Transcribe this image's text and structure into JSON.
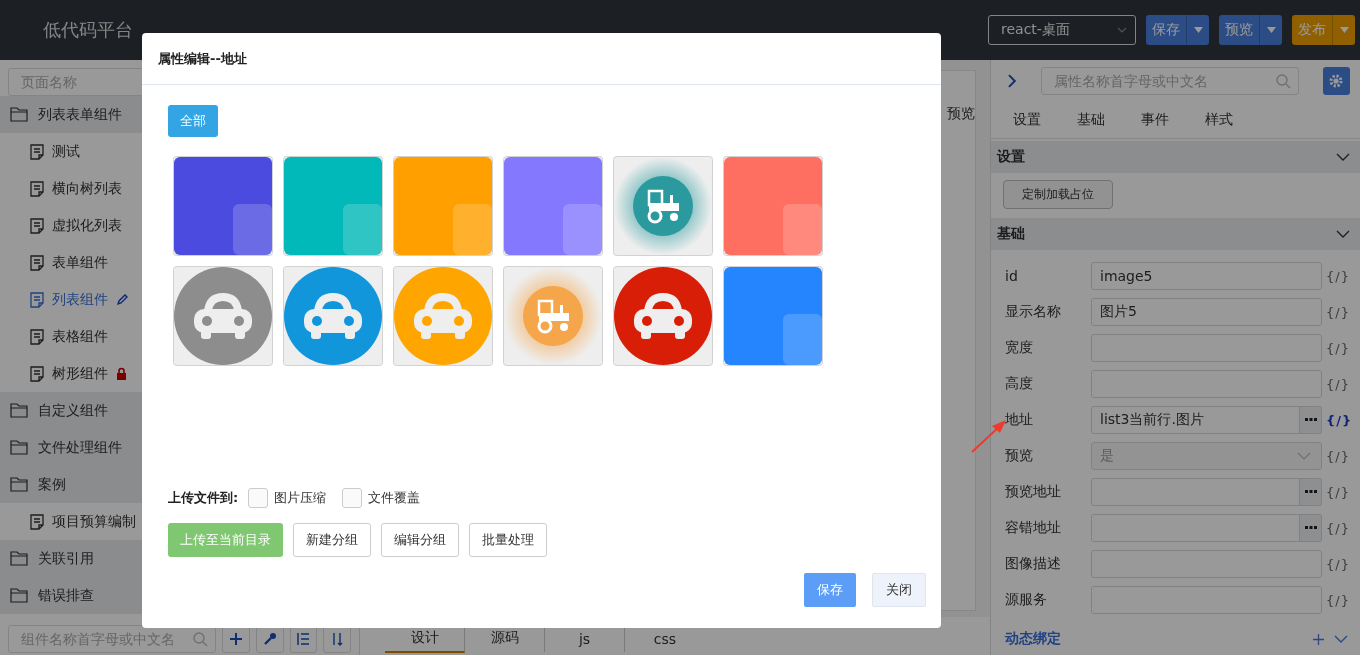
{
  "header": {
    "logo": "低代码平台",
    "env_select": "react-桌面",
    "actions": [
      {
        "label": "保存",
        "kind": "primary"
      },
      {
        "label": "预览",
        "kind": "primary"
      },
      {
        "label": "发布",
        "kind": "warning"
      }
    ]
  },
  "sidebar": {
    "search_placeholder": "页面名称",
    "tree": [
      {
        "label": "列表表单组件",
        "selected": false,
        "children": [
          {
            "label": "测试",
            "selected": false,
            "editing": false,
            "locked": false
          },
          {
            "label": "横向树列表",
            "selected": false,
            "editing": false,
            "locked": false
          },
          {
            "label": "虚拟化列表",
            "selected": false,
            "editing": false,
            "locked": false
          },
          {
            "label": "表单组件",
            "selected": false,
            "editing": false,
            "locked": false
          },
          {
            "label": "列表组件",
            "selected": true,
            "editing": true,
            "locked": false
          },
          {
            "label": "表格组件",
            "selected": false,
            "editing": false,
            "locked": false
          },
          {
            "label": "树形组件",
            "selected": false,
            "editing": false,
            "locked": true
          }
        ]
      },
      {
        "label": "自定义组件",
        "selected": false
      },
      {
        "label": "文件处理组件",
        "selected": false
      },
      {
        "label": "案例",
        "selected": false,
        "children": [
          {
            "label": "项目预算编制",
            "selected": false,
            "editing": false,
            "locked": false
          }
        ]
      },
      {
        "label": "关联引用",
        "selected": false
      },
      {
        "label": "错误排查",
        "selected": false
      }
    ],
    "bottom_search_placeholder": "组件名称首字母或中文名"
  },
  "center": {
    "preview_label": "预览",
    "tabs": [
      {
        "label": "设计",
        "selected": true
      },
      {
        "label": "源码",
        "selected": false
      },
      {
        "label": "js",
        "selected": false
      },
      {
        "label": "css",
        "selected": false
      }
    ]
  },
  "properties": {
    "search_placeholder": "属性名称首字母或中文名",
    "tabs": [
      {
        "label": "设置"
      },
      {
        "label": "基础"
      },
      {
        "label": "事件"
      },
      {
        "label": "样式"
      }
    ],
    "settings": {
      "title": "设置",
      "expanded": true,
      "buttons": [
        "定制加载占位"
      ]
    },
    "basic": {
      "title": "基础",
      "expanded": true,
      "fields": [
        {
          "label": "id",
          "kind": "text",
          "value": "image5",
          "disabled": false,
          "binding": "{/}",
          "bound": false
        },
        {
          "label": "显示名称",
          "kind": "text",
          "value": "图片5",
          "disabled": false,
          "binding": "{/}",
          "bound": false
        },
        {
          "label": "宽度",
          "kind": "text",
          "disabled": false,
          "binding": "{/}",
          "bound": false
        },
        {
          "label": "高度",
          "kind": "text",
          "disabled": false,
          "binding": "{/}",
          "bound": false
        },
        {
          "label": "地址",
          "kind": "picker",
          "value": "list3当前行.图片",
          "disabled": false,
          "binding": "{/}",
          "bound": true
        },
        {
          "label": "预览",
          "kind": "select",
          "value": "是",
          "disabled": true,
          "binding": "{/}",
          "bound": false
        },
        {
          "label": "预览地址",
          "kind": "picker",
          "disabled": false,
          "binding": "{/}",
          "bound": false
        },
        {
          "label": "容错地址",
          "kind": "picker",
          "disabled": false,
          "binding": "{/}",
          "bound": false
        },
        {
          "label": "图像描述",
          "kind": "text",
          "disabled": false,
          "binding": "{/}",
          "bound": false
        },
        {
          "label": "源服务",
          "kind": "text",
          "disabled": false,
          "binding": "{/}",
          "bound": false
        }
      ]
    },
    "dynamic_binding": {
      "title": "动态绑定",
      "expanded": true
    }
  },
  "modal": {
    "title": "属性编辑--地址",
    "groups": [
      {
        "label": "全部",
        "selected": true
      }
    ],
    "images": [
      {
        "kind": "tile",
        "color": "#4b4be0"
      },
      {
        "kind": "tile",
        "color": "#02b9b9"
      },
      {
        "kind": "tile",
        "color": "#ffa000"
      },
      {
        "kind": "tile",
        "color": "#8479fe"
      },
      {
        "kind": "tractor",
        "color": "#2a9a9e"
      },
      {
        "kind": "tile",
        "color": "#ff6f61"
      },
      {
        "kind": "car",
        "color": "#8d8d8d"
      },
      {
        "kind": "car",
        "color": "#1296db"
      },
      {
        "kind": "car",
        "color": "#ffa500"
      },
      {
        "kind": "tractor",
        "color": "#f5a54a"
      },
      {
        "kind": "car",
        "color": "#d81e06"
      },
      {
        "kind": "tile",
        "color": "#2485ff"
      }
    ],
    "upload_label": "上传文件到:",
    "options": [
      {
        "label": "图片压缩",
        "checked": false
      },
      {
        "label": "文件覆盖",
        "checked": false
      }
    ],
    "buttons": [
      {
        "label": "上传至当前目录",
        "kind": "success"
      },
      {
        "label": "新建分组",
        "kind": "default"
      },
      {
        "label": "编辑分组",
        "kind": "default"
      },
      {
        "label": "批量处理",
        "kind": "default"
      }
    ],
    "footer": [
      {
        "label": "保存",
        "kind": "primary"
      },
      {
        "label": "关闭",
        "kind": "plain"
      }
    ]
  }
}
